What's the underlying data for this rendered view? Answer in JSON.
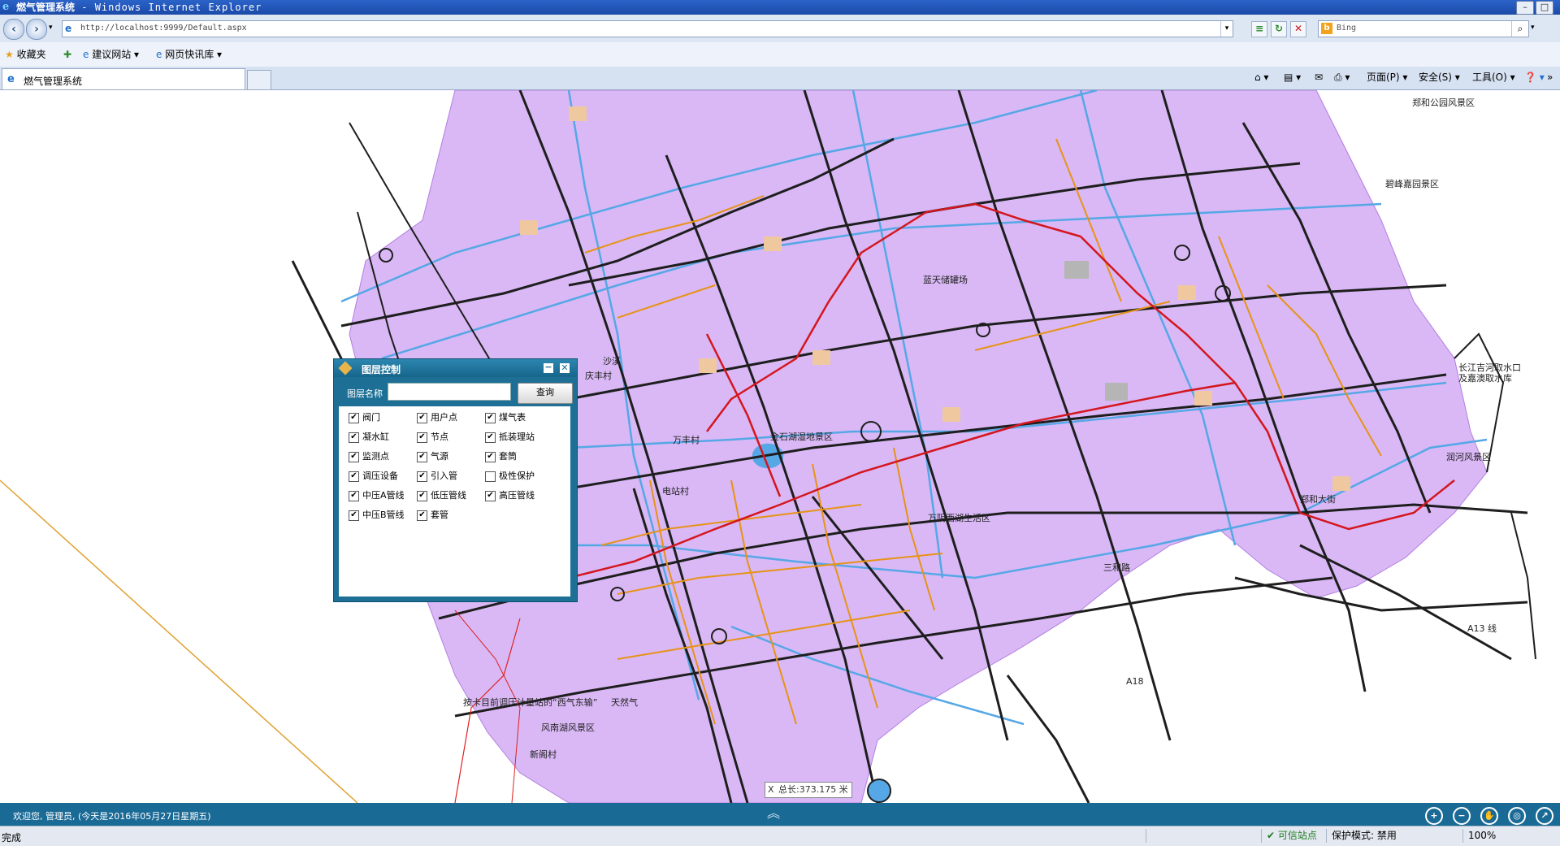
{
  "window": {
    "title_cn": "燃气管理系统",
    "title_suffix": " - Windows Internet Explorer",
    "minimize": "–",
    "maximize": "□"
  },
  "addressbar": {
    "url": "http://localhost:9999/Default.aspx",
    "search_placeholder": "Bing",
    "refresh_icon": "↻",
    "stop_icon": "✕"
  },
  "favorites_bar": {
    "favorites": "收藏夹",
    "item1": "建议网站 ▾",
    "item2": "网页快讯库 ▾"
  },
  "tabs": {
    "active": "燃气管理系统"
  },
  "command_bar": {
    "page": "页面(P) ▾",
    "safety": "安全(S) ▾",
    "tools": "工具(O) ▾",
    "help": "❓ ▾"
  },
  "map": {
    "labels": {
      "l1": "长江吉河取水口",
      "l2": "及嘉澳取水库",
      "l3": "润河风景区",
      "l4": "金石湖湿地景区",
      "l5": "天然气",
      "l6": "按卡目前调压计量站的“西气东输”",
      "l7": "风南湖风景区",
      "l8": "新阁村",
      "l9": "万阴西湖生活区",
      "l10": "郑和大街",
      "l11": "三和路",
      "l12": "蓝天储罐场",
      "l13": "庆丰村",
      "l14": "沙溪",
      "l15": "万丰村",
      "l16": "电站村",
      "l17": "A13 线",
      "l18": "A18",
      "l19": "郑和公园风景区",
      "l20": "碧峰嘉园景区"
    },
    "measure": {
      "close": "X",
      "text": "总长:373.175 米"
    }
  },
  "layer_panel": {
    "title": "图层控制",
    "minimize": "−",
    "close": "✕",
    "name_label": "图层名称",
    "name_value": "",
    "query_button": "查询",
    "layers": [
      {
        "label": "阀门",
        "checked": "✔"
      },
      {
        "label": "用户点",
        "checked": "✔"
      },
      {
        "label": "煤气表",
        "checked": "✔"
      },
      {
        "label": "凝水缸",
        "checked": "✔"
      },
      {
        "label": "节点",
        "checked": "✔"
      },
      {
        "label": "抵装理站",
        "checked": "✔"
      },
      {
        "label": "监测点",
        "checked": "✔"
      },
      {
        "label": "气源",
        "checked": "✔"
      },
      {
        "label": "套筒",
        "checked": "✔"
      },
      {
        "label": "调压设备",
        "checked": "✔"
      },
      {
        "label": "引入管",
        "checked": "✔"
      },
      {
        "label": "极性保护",
        "checked": ""
      },
      {
        "label": "中压A管线",
        "checked": "✔"
      },
      {
        "label": "低压管线",
        "checked": "✔"
      },
      {
        "label": "高压管线",
        "checked": "✔"
      },
      {
        "label": "中压B管线",
        "checked": "✔"
      },
      {
        "label": "套管",
        "checked": "✔"
      }
    ]
  },
  "app_status": {
    "welcome": "欢迎您, 管理员, (今天是2016年05月27日星期五)",
    "collapse": "︽",
    "tools": [
      {
        "name": "zoom-in",
        "glyph": "+"
      },
      {
        "name": "zoom-out",
        "glyph": "−"
      },
      {
        "name": "pan",
        "glyph": "✋"
      },
      {
        "name": "full-extent",
        "glyph": "◎"
      },
      {
        "name": "measure",
        "glyph": "↗"
      }
    ]
  },
  "ie_status": {
    "done": "完成",
    "trusted": "✔ 可信站点",
    "protected": "保护模式: 禁用",
    "zoom": "100%"
  },
  "colors": {
    "map_fill": "#d9b8f5",
    "major_road": "#1e1e1e",
    "gas_pipe_medium": "#e69317",
    "gas_pipe_high": "#d4161e",
    "river": "#56a7e6",
    "status_bar": "#1a6a96"
  }
}
